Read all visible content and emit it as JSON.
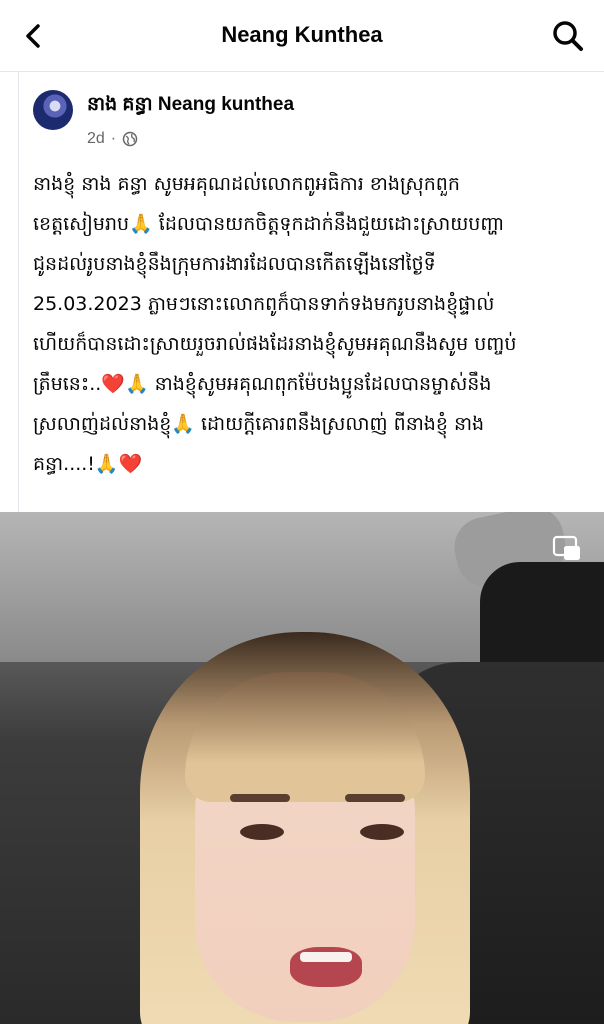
{
  "nav": {
    "title": "Neang Kunthea",
    "back_icon": "chevron-left-icon",
    "search_icon": "search-icon"
  },
  "post": {
    "author": "នាង គន្ធា Neang kunthea",
    "time": "2d",
    "separator": "·",
    "audience_icon": "globe-icon",
    "lines": [
      "នាងខ្ញុំ នាង គន្ធា សូមអគុណដល់លោកពូអធិការ ខាងស្រុកពួក",
      "ខេត្តសៀមរាប🙏 ដែលបានយកចិត្តទុកដាក់នឹងជួយដោះស្រាយបញ្ហា",
      "ជូនដល់រូបនាងខ្ញុំនឹងក្រុមការងារដែលបានកើតឡើងនៅថ្ងៃទី",
      "25.03.2023 ភ្លាមៗនោះលោកពូក៏បានទាក់ទងមករូបនាងខ្ញុំផ្ទាល់",
      "ហើយក៏បានដោះស្រាយរួចរាល់ផងដែរនាងខ្ញុំសូមអគុណនឹងសូម បញ្ចប់",
      "ត្រឹមនេះ..❤️🙏 នាងខ្ញុំសូមអគុណពុកម៉ែបងប្អូនដែលបានម្ចាស់នឹង",
      "ស្រលាញ់ដល់នាងខ្ញុំ🙏 ដោយក្តីគោរពនឹងស្រលាញ់ ពីនាងខ្ញុំ នាង",
      "គន្ធា....!🙏❤️"
    ]
  },
  "video": {
    "pip_icon": "picture-in-picture-icon"
  }
}
